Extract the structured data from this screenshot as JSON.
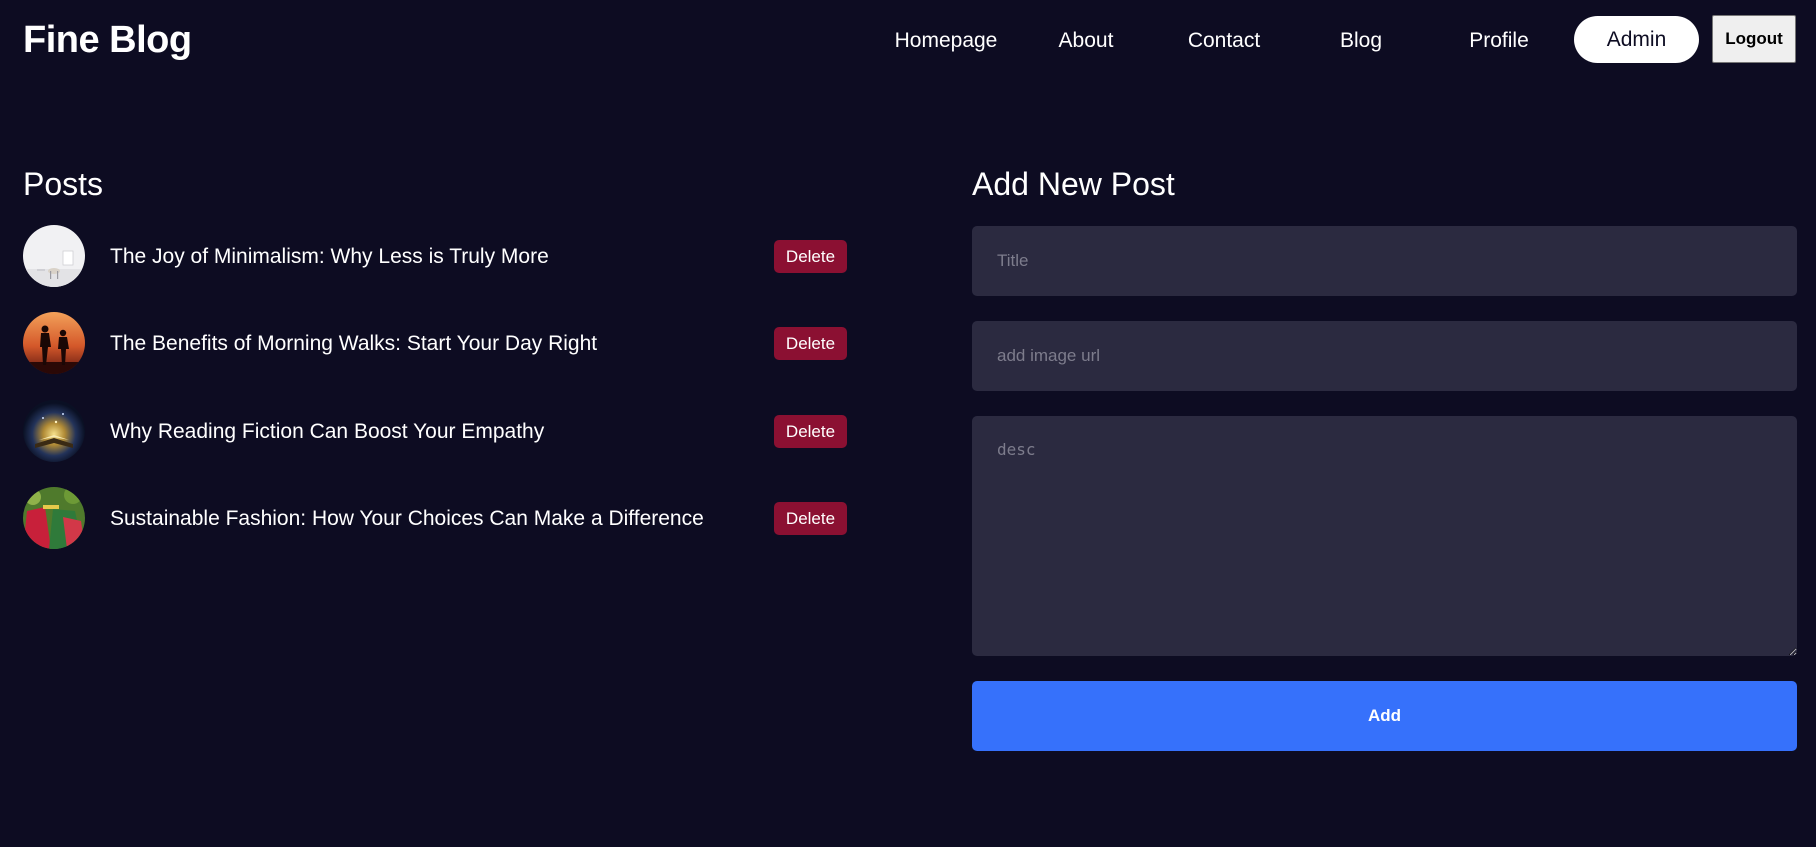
{
  "header": {
    "logo": "Fine Blog",
    "nav": {
      "homepage": "Homepage",
      "about": "About",
      "contact": "Contact",
      "blog": "Blog",
      "profile": "Profile"
    },
    "admin_label": "Admin",
    "logout_label": "Logout"
  },
  "posts": {
    "title": "Posts",
    "delete_label": "Delete",
    "items": [
      {
        "title": "The Joy of Minimalism: Why Less is Truly More",
        "thumbnail": "minimal-white-room-image"
      },
      {
        "title": "The Benefits of Morning Walks: Start Your Day Right",
        "thumbnail": "sunset-walkers-image"
      },
      {
        "title": "Why Reading Fiction Can Boost Your Empathy",
        "thumbnail": "glowing-book-image"
      },
      {
        "title": "Sustainable Fashion: How Your Choices Can Make a Difference",
        "thumbnail": "colorful-clothing-image"
      }
    ]
  },
  "form": {
    "title": "Add New Post",
    "title_placeholder": "Title",
    "image_placeholder": "add image url",
    "desc_placeholder": "desc",
    "submit_label": "Add"
  },
  "colors": {
    "background": "#0d0c22",
    "input_background": "#2b2a40",
    "delete_button": "#8b1032",
    "add_button": "#3671fb",
    "admin_button": "#ffffff"
  }
}
